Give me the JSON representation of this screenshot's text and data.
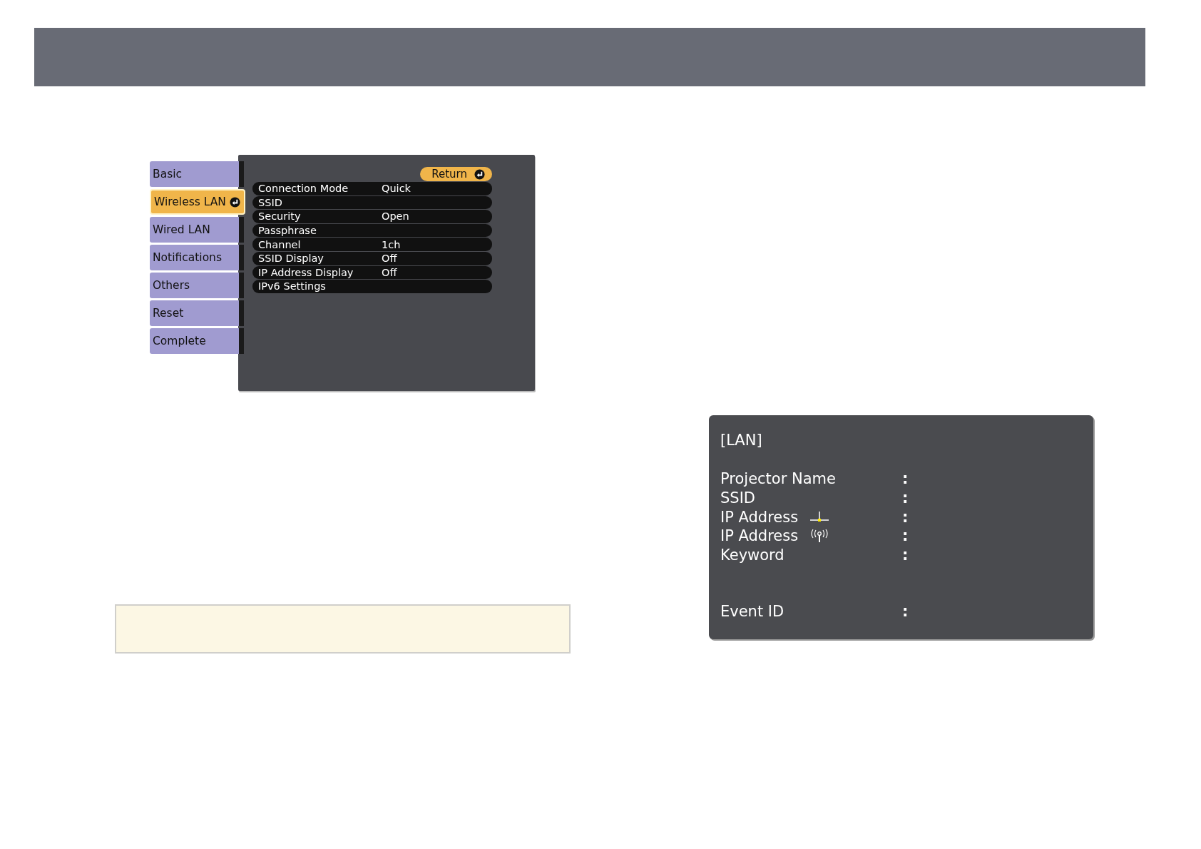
{
  "menu": {
    "tabs": [
      {
        "label": "Basic",
        "selected": false
      },
      {
        "label": "Wireless LAN",
        "selected": true
      },
      {
        "label": "Wired LAN",
        "selected": false
      },
      {
        "label": "Notifications",
        "selected": false
      },
      {
        "label": "Others",
        "selected": false
      },
      {
        "label": "Reset",
        "selected": false
      },
      {
        "label": "Complete",
        "selected": false
      }
    ],
    "return_button": {
      "label": "Return"
    },
    "rows": [
      {
        "label": "Connection Mode",
        "value": "Quick"
      },
      {
        "label": "SSID"
      },
      {
        "label": "Security",
        "value": "Open"
      },
      {
        "label": "Passphrase"
      },
      {
        "label": "Channel",
        "value": "1ch"
      },
      {
        "label": "SSID Display",
        "value": "Off"
      },
      {
        "label": "IP Address Display",
        "value": "Off"
      },
      {
        "label": "IPv6 Settings"
      }
    ]
  },
  "lan_info": {
    "title": "[LAN]",
    "rows": [
      {
        "label": "Projector Name",
        "separator": ":"
      },
      {
        "label": "SSID",
        "separator": ":"
      },
      {
        "label": "IP Address",
        "kind": "wired",
        "separator": ":"
      },
      {
        "label": "IP Address",
        "kind": "wireless",
        "separator": ":"
      },
      {
        "label": "Keyword",
        "separator": ":"
      }
    ],
    "footer_rows": [
      {
        "label": "Event ID",
        "separator": ":"
      }
    ]
  },
  "note_box": {
    "kind": "note"
  }
}
